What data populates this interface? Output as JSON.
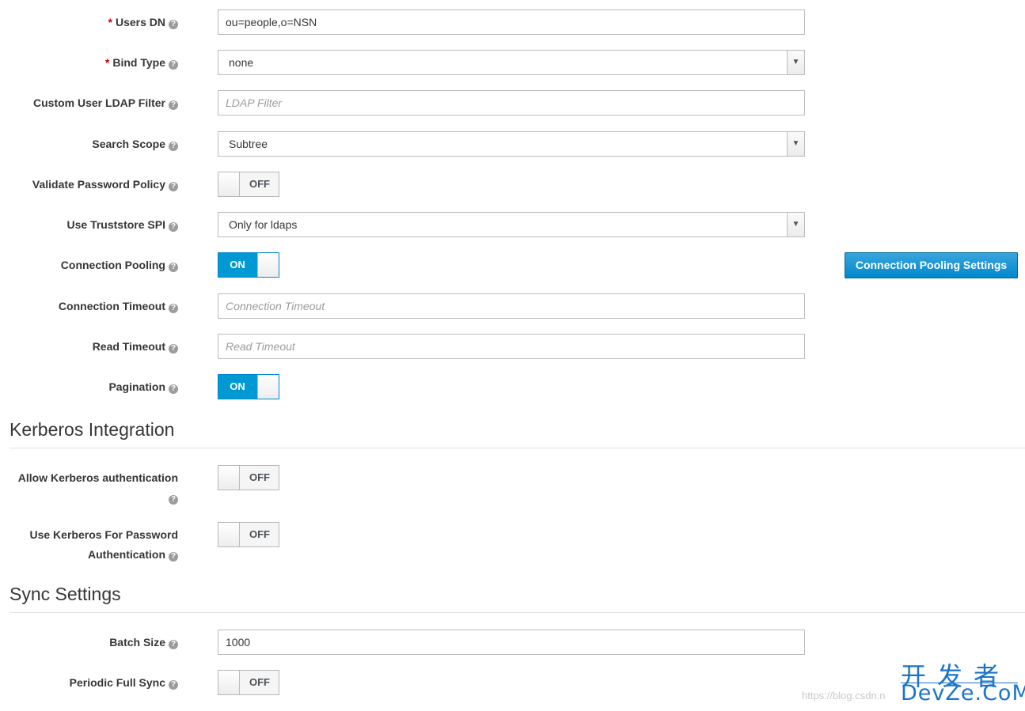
{
  "fields": {
    "users_dn": {
      "label": "Users DN",
      "required": "*",
      "value": "ou=people,o=NSN"
    },
    "bind_type": {
      "label": "Bind Type",
      "required": "*",
      "value": "none"
    },
    "custom_filter": {
      "label": "Custom User LDAP Filter",
      "placeholder": "LDAP Filter"
    },
    "search_scope": {
      "label": "Search Scope",
      "value": "Subtree"
    },
    "validate_password_policy": {
      "label": "Validate Password Policy",
      "state": "OFF"
    },
    "use_truststore_spi": {
      "label": "Use Truststore SPI",
      "value": "Only for ldaps"
    },
    "connection_pooling": {
      "label": "Connection Pooling",
      "state": "ON",
      "settings_button": "Connection Pooling Settings"
    },
    "connection_timeout": {
      "label": "Connection Timeout",
      "placeholder": "Connection Timeout"
    },
    "read_timeout": {
      "label": "Read Timeout",
      "placeholder": "Read Timeout"
    },
    "pagination": {
      "label": "Pagination",
      "state": "ON"
    }
  },
  "kerberos": {
    "title": "Kerberos Integration",
    "allow_kerberos": {
      "label": "Allow Kerberos authentication",
      "state": "OFF"
    },
    "use_kerberos_password": {
      "label": "Use Kerberos For Password Authentication",
      "state": "OFF"
    }
  },
  "sync": {
    "title": "Sync Settings",
    "batch_size": {
      "label": "Batch Size",
      "value": "1000"
    },
    "periodic_full_sync": {
      "label": "Periodic Full Sync",
      "state": "OFF"
    }
  },
  "icons": {
    "help": "question-circle-icon",
    "dropdown": "chevron-down-icon"
  },
  "help_glyph": "?",
  "arrow_glyph": "▼",
  "watermark": {
    "cn": "开发者",
    "en": "DevZe.CoM",
    "url": "https://blog.csdn.n"
  },
  "colors": {
    "accent": "#0099d3",
    "required": "#cc0000",
    "text": "#363636"
  }
}
